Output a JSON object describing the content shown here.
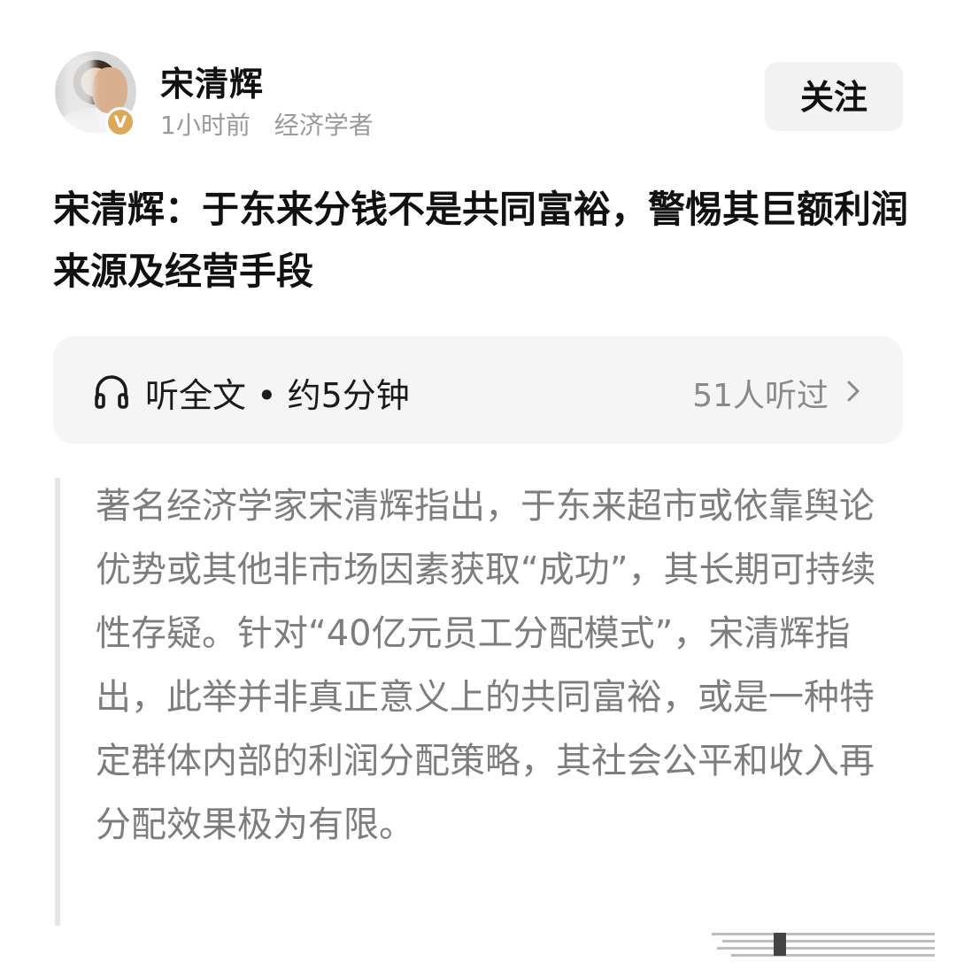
{
  "author": {
    "name": "宋清辉",
    "verified_badge": "V",
    "time_ago": "1小时前",
    "tagline": "经济学者"
  },
  "follow_button": "关注",
  "article": {
    "title": "宋清辉：于东来分钱不是共同富裕，警惕其巨额利润来源及经营手段"
  },
  "listen": {
    "label": "听全文 • 约5分钟",
    "count": "51人听过",
    "icon": "headphone-icon"
  },
  "summary": "著名经济学家宋清辉指出，于东来超市或依靠舆论优势或其他非市场因素获取“成功”，其长期可持续性存疑。针对“40亿元员工分配模式”，宋清辉指出，此举并非真正意义上的共同富裕，或是一种特定群体内部的利润分配策略，其社会公平和收入再分配效果极为有限。",
  "colors": {
    "badge": "#dca85a",
    "listen_bg": "#f5f5f5",
    "summary_text": "#7d7d7d",
    "quote_bar": "#e6e6e6"
  }
}
